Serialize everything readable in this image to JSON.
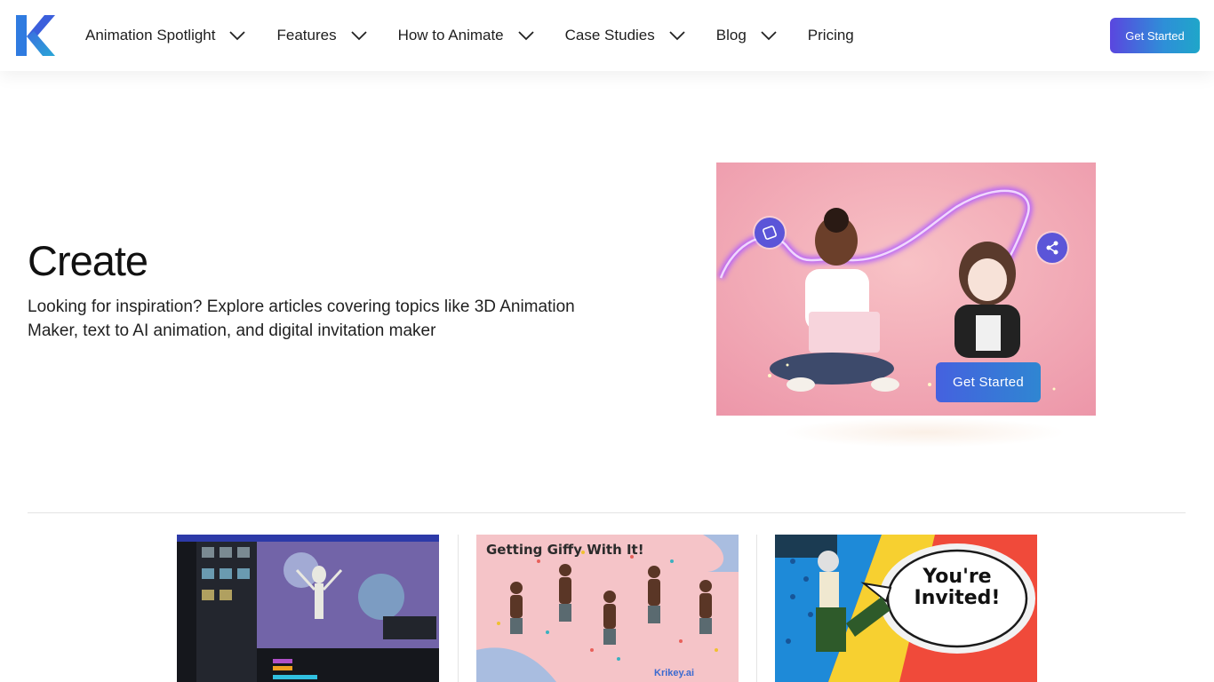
{
  "nav": {
    "items": [
      {
        "label": "Animation Spotlight"
      },
      {
        "label": "Features"
      },
      {
        "label": "How to Animate"
      },
      {
        "label": "Case Studies"
      },
      {
        "label": "Blog"
      },
      {
        "label": "Pricing"
      }
    ],
    "cta_label": "Get Started"
  },
  "hero": {
    "title": "Create",
    "description": "Looking for inspiration? Explore articles covering topics like 3D Animation Maker, text to AI animation, and digital invitation maker",
    "image_cta_label": "Get Started"
  },
  "cards": [
    {
      "title_text": ""
    },
    {
      "title_text": "Getting Giffy With It!",
      "brand": "Krikey.ai"
    },
    {
      "title_text": "You're Invited!"
    }
  ],
  "colors": {
    "accent_start": "#5a46df",
    "accent_end": "#1fa6c9",
    "hero_bg": "#f2a5b2"
  }
}
